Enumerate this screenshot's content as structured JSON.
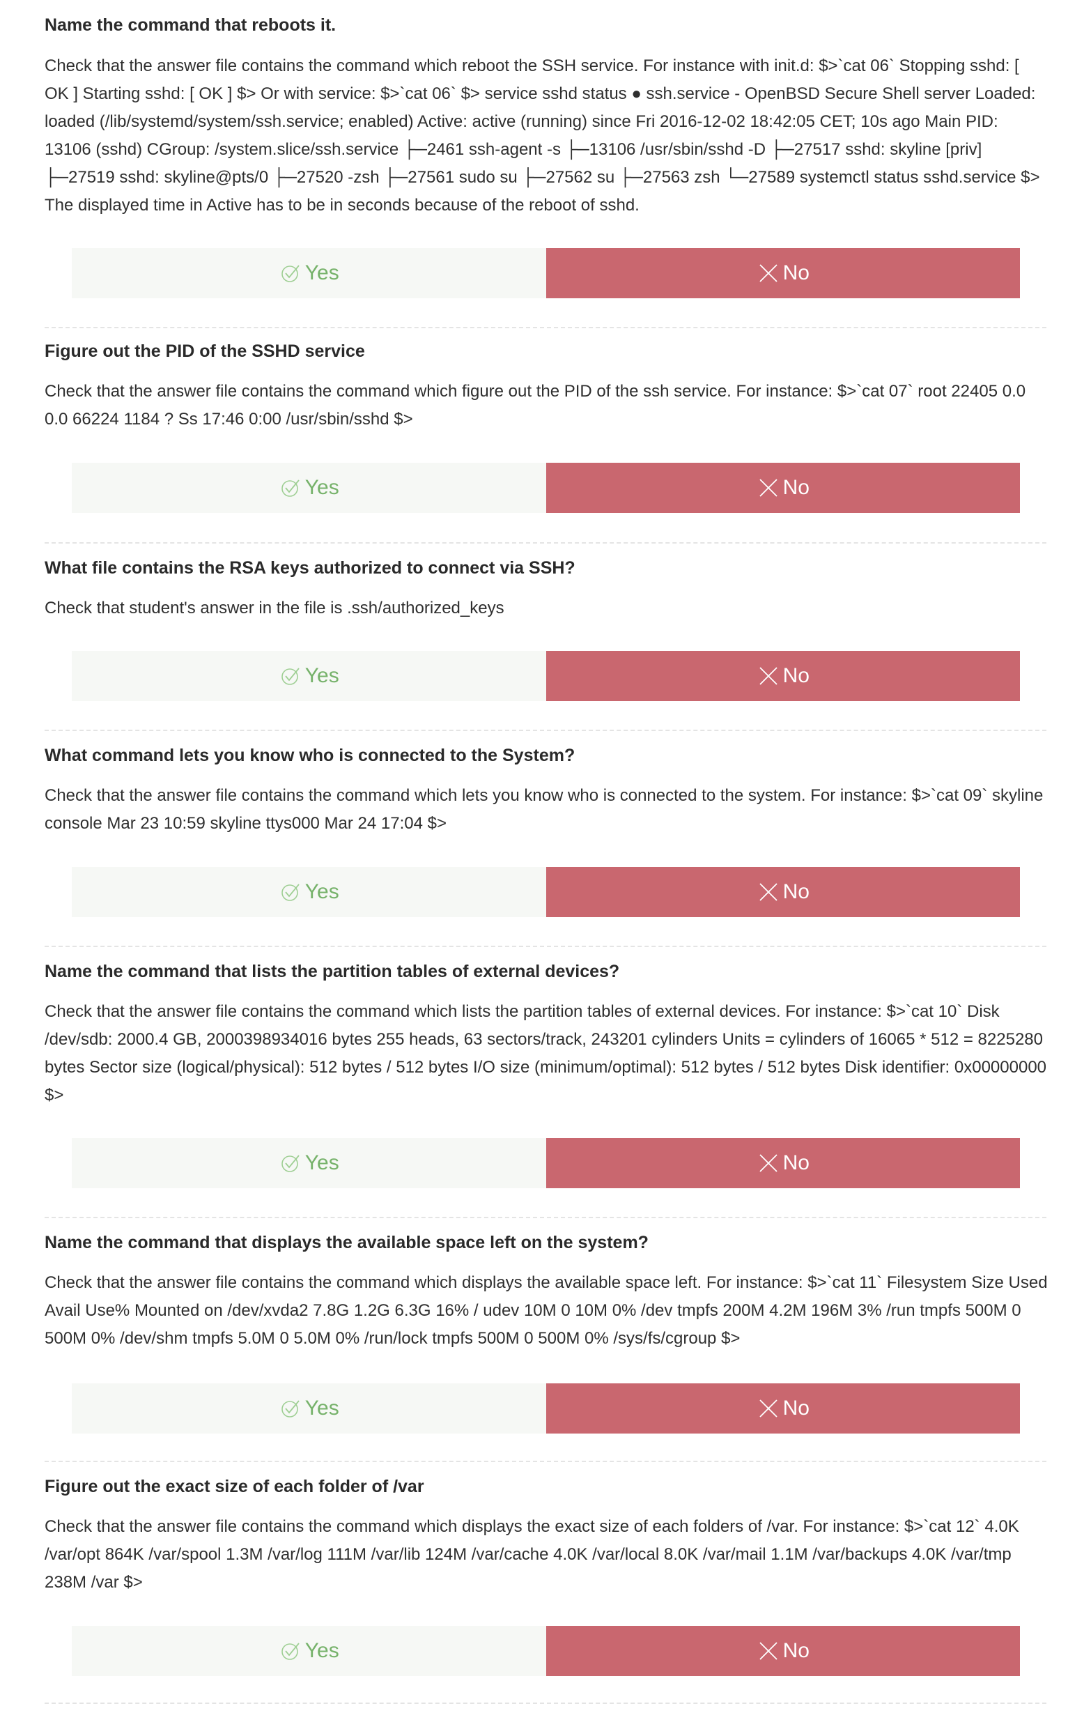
{
  "buttons": {
    "yes_label": "Yes",
    "no_label": "No",
    "yes_icon": "check-circle-icon",
    "no_icon": "cross-icon",
    "yes_color": "#76b26a",
    "yes_bg": "#f6f8f5",
    "no_bg": "#c9676f"
  },
  "questions": [
    {
      "title": "Name the command that reboots it.",
      "body": "Check that the answer file contains the command which reboot the SSH service. For instance with init.d: $>`cat 06` Stopping sshd: [ OK ] Starting sshd: [ OK ] $> Or with service: $>`cat 06` $> service sshd status ● ssh.service - OpenBSD Secure Shell server Loaded: loaded (/lib/systemd/system/ssh.service; enabled) Active: active (running) since Fri 2016-12-02 18:42:05 CET; 10s ago Main PID: 13106 (sshd) CGroup: /system.slice/ssh.service ├─2461 ssh-agent -s ├─13106 /usr/sbin/sshd -D ├─27517 sshd: skyline [priv] ├─27519 sshd: skyline@pts/0 ├─27520 -zsh ├─27561 sudo su ├─27562 su ├─27563 zsh └─27589 systemctl status sshd.service $> The displayed time in Active has to be in seconds because of the reboot of sshd."
    },
    {
      "title": "Figure out the PID of the SSHD service",
      "body": "Check that the answer file contains the command which figure out the PID of the ssh service. For instance: $>`cat 07` root 22405 0.0 0.0 66224 1184 ? Ss 17:46 0:00 /usr/sbin/sshd $>"
    },
    {
      "title": "What file contains the RSA keys authorized to connect via SSH?",
      "body": "Check that student's answer in the file is .ssh/authorized_keys"
    },
    {
      "title": "What command lets you know who is connected to the System?",
      "body": "Check that the answer file contains the command which lets you know who is connected to the system. For instance: $>`cat 09` skyline console Mar 23 10:59 skyline ttys000 Mar 24 17:04 $>"
    },
    {
      "title": "Name the command that lists the partition tables of external devices?",
      "body": "Check that the answer file contains the command which lists the partition tables of external devices. For instance: $>`cat 10` Disk /dev/sdb: 2000.4 GB, 2000398934016 bytes 255 heads, 63 sectors/track, 243201 cylinders Units = cylinders of 16065 * 512 = 8225280 bytes Sector size (logical/physical): 512 bytes / 512 bytes I/O size (minimum/optimal): 512 bytes / 512 bytes Disk identifier: 0x00000000 $>"
    },
    {
      "title": "Name the command that displays the available space left on the system?",
      "body": "Check that the answer file contains the command which displays the available space left. For instance: $>`cat 11` Filesystem Size Used Avail Use% Mounted on /dev/xvda2 7.8G 1.2G 6.3G 16% / udev 10M 0 10M 0% /dev tmpfs 200M 4.2M 196M 3% /run tmpfs 500M 0 500M 0% /dev/shm tmpfs 5.0M 0 5.0M 0% /run/lock tmpfs 500M 0 500M 0% /sys/fs/cgroup $>"
    },
    {
      "title": "Figure out the exact size of each folder of /var",
      "body": "Check that the answer file contains the command which displays the exact size of each folders of /var. For instance: $>`cat 12` 4.0K /var/opt 864K /var/spool 1.3M /var/log 111M /var/lib 124M /var/cache 4.0K /var/local 8.0K /var/mail 1.1M /var/backups 4.0K /var/tmp 238M /var $>"
    }
  ]
}
